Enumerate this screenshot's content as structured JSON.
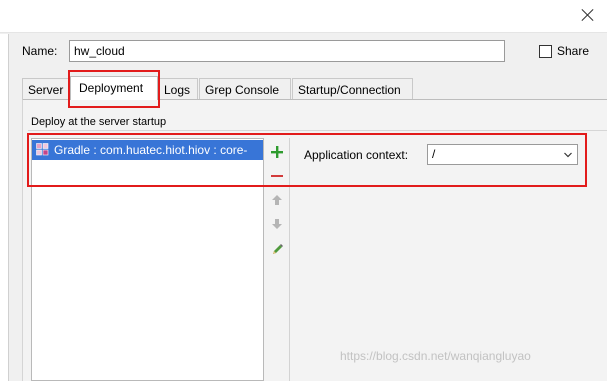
{
  "dialog": {
    "close_icon": "close-icon"
  },
  "name": {
    "label": "Name:",
    "value": "hw_cloud"
  },
  "share": {
    "label": "Share",
    "checked": false
  },
  "tabs": [
    {
      "label": "Server",
      "active": false
    },
    {
      "label": "Deployment",
      "active": true
    },
    {
      "label": "Logs",
      "active": false
    },
    {
      "label": "Grep Console",
      "active": false
    },
    {
      "label": "Startup/Connection",
      "active": false
    }
  ],
  "deploy": {
    "group_title": "Deploy at the server startup",
    "items": [
      {
        "label": "Gradle : com.huatec.hiot.hiov : core-",
        "icon": "gradle-artifact-icon",
        "selected": true
      }
    ],
    "toolbar": {
      "add_icon": "plus-icon",
      "remove_icon": "minus-icon",
      "up_icon": "arrow-up-icon",
      "down_icon": "arrow-down-icon",
      "edit_icon": "pencil-icon"
    },
    "context": {
      "label": "Application context:",
      "value": "/"
    }
  },
  "watermark": "https://blog.csdn.net/wanqiangluyao",
  "colors": {
    "selection": "#3875d7",
    "highlight": "#e21b1b",
    "add": "#2e9b2e",
    "remove": "#d23a3a"
  }
}
